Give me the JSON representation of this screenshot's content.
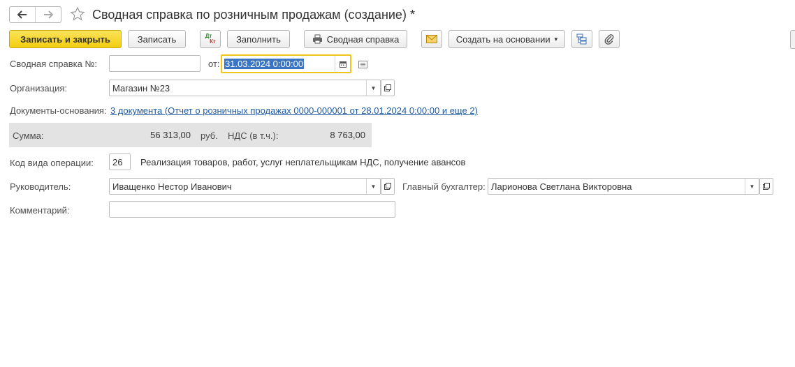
{
  "window": {
    "title": "Сводная справка по розничным продажам (создание) *"
  },
  "toolbar": {
    "save_close": "Записать и закрыть",
    "save": "Записать",
    "dt_kt_top": "Дт",
    "dt_kt_bottom": "Кт",
    "fill": "Заполнить",
    "print_summary": "Сводная справка",
    "create_based": "Создать на основании",
    "dropdown_arrow": "▾"
  },
  "form": {
    "number_label": "Сводная справка №:",
    "number_value": "",
    "date_label": "от:",
    "date_value": "31.03.2024  0:00:00",
    "org_label": "Организация:",
    "org_value": "Магазин №23",
    "docs_label": "Документы-основания:",
    "docs_link": "3 документа (Отчет о розничных продажах 0000-000001 от 28.01.2024 0:00:00 и еще 2)",
    "sum_label": "Сумма:",
    "sum_value": "56 313,00",
    "currency": "руб.",
    "vat_label": "НДС (в т.ч.):",
    "vat_value": "8 763,00",
    "op_code_label": "Код вида операции:",
    "op_code_value": "26",
    "op_code_desc": "Реализация товаров, работ, услуг неплательщикам НДС, получение авансов",
    "head_label": "Руководитель:",
    "head_value": "Иващенко Нестор Иванович",
    "accountant_label": "Главный бухгалтер:",
    "accountant_value": "Ларионова Светлана Викторовна",
    "comment_label": "Комментарий:",
    "comment_value": ""
  },
  "colors": {
    "primary_button": "#f4cd0f",
    "link": "#1f5aa3",
    "date_focus_border": "#f0c419",
    "selection": "#3a75c4",
    "sum_panel": "#e3e3e3"
  }
}
